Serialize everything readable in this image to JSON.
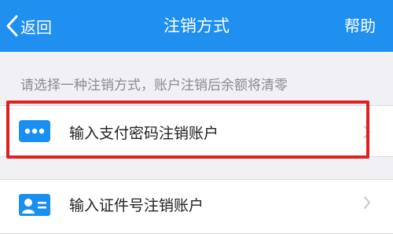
{
  "nav": {
    "back_label": "返回",
    "title": "注销方式",
    "help_label": "帮助"
  },
  "hint": "请选择一种注销方式，账户注销后余额将清零",
  "options": [
    {
      "label": "输入支付密码注销账户",
      "icon": "password-dots-icon"
    },
    {
      "label": "输入证件号注销账户",
      "icon": "id-card-icon"
    }
  ],
  "colors": {
    "nav_background": "#1f8ff0",
    "icon_blue": "#1a8ff2",
    "highlight_red": "#e0201e",
    "page_background": "#f0f0f5"
  }
}
